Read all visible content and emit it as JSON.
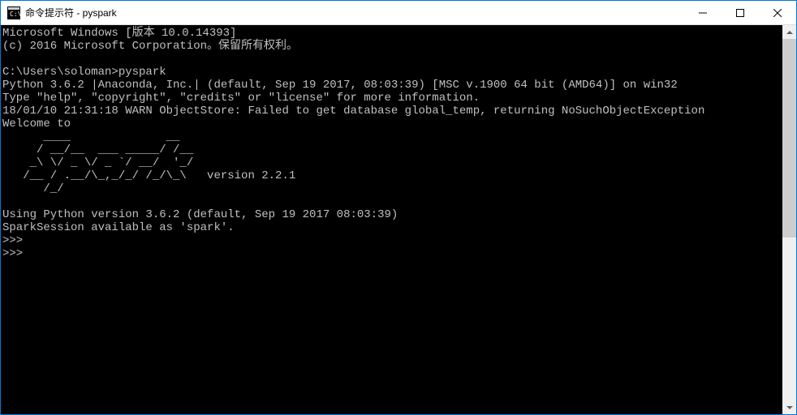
{
  "titlebar": {
    "title": "命令提示符 - pyspark"
  },
  "terminal": {
    "line1": "Microsoft Windows [版本 10.0.14393]",
    "line2": "(c) 2016 Microsoft Corporation。保留所有权利。",
    "blank1": "",
    "prompt1": "C:\\Users\\soloman>pyspark",
    "python_line": "Python 3.6.2 |Anaconda, Inc.| (default, Sep 19 2017, 08:03:39) [MSC v.1900 64 bit (AMD64)] on win32",
    "help_line": "Type \"help\", \"copyright\", \"credits\" or \"license\" for more information.",
    "warn_line": "18/01/10 21:31:18 WARN ObjectStore: Failed to get database global_temp, returning NoSuchObjectException",
    "welcome": "Welcome to",
    "ascii1": "      ____              __",
    "ascii2": "     / __/__  ___ _____/ /__",
    "ascii3": "    _\\ \\/ _ \\/ _ `/ __/  '_/",
    "ascii4": "   /__ / .__/\\_,_/_/ /_/\\_\\   version 2.2.1",
    "ascii5": "      /_/",
    "blank2": "",
    "using_line": "Using Python version 3.6.2 (default, Sep 19 2017 08:03:39)",
    "session_line": "SparkSession available as 'spark'.",
    "prompt2": ">>>",
    "prompt3": ">>> "
  }
}
